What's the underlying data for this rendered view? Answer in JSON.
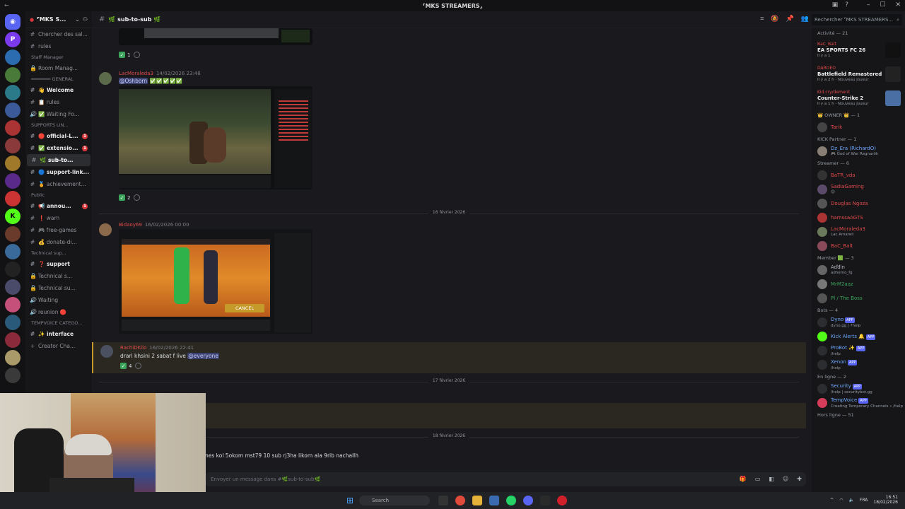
{
  "window": {
    "title": "⸢MKS STREAMERS⸥",
    "search_placeholder": "Rechercher ⸢MKS STREAMERS..."
  },
  "server": {
    "name": "⸢MKS S..."
  },
  "channels": [
    {
      "type": "channel",
      "icon": "hash-icon",
      "label": "Chercher des sal..."
    },
    {
      "type": "channel",
      "icon": "hash-icon",
      "label": "rules"
    },
    {
      "type": "category",
      "label": "Staff Manager"
    },
    {
      "type": "channel",
      "icon": "lock-icon",
      "label": "Room Manag..."
    },
    {
      "type": "category",
      "label": "━━━━━━━ GENERAL"
    },
    {
      "type": "channel",
      "icon": "hash-icon",
      "label": "👋 Welcome",
      "bold": true
    },
    {
      "type": "channel",
      "icon": "hash-icon",
      "label": "📋 rules"
    },
    {
      "type": "channel",
      "icon": "speaker-icon",
      "label": "✅ Waiting Fo..."
    },
    {
      "type": "category",
      "label": "SUPPORTS LIN..."
    },
    {
      "type": "channel",
      "icon": "hash-icon",
      "label": "🔴 official-L...",
      "bold": true,
      "badge": "1"
    },
    {
      "type": "channel",
      "icon": "hash-icon",
      "label": "✅ extensio...",
      "bold": true,
      "badge": "1"
    },
    {
      "type": "channel",
      "icon": "hash-icon",
      "label": "🌿 sub-to...",
      "bold": true,
      "active": true
    },
    {
      "type": "channel",
      "icon": "hash-icon",
      "label": "🔵 support-link...",
      "bold": true
    },
    {
      "type": "channel",
      "icon": "hash-icon",
      "label": "🏅 achievement..."
    },
    {
      "type": "category",
      "label": "Public"
    },
    {
      "type": "channel",
      "icon": "hash-icon",
      "label": "📢 annou...",
      "bold": true,
      "badge": "1"
    },
    {
      "type": "channel",
      "icon": "hash-icon",
      "label": "❗ warn"
    },
    {
      "type": "channel",
      "icon": "hash-icon",
      "label": "🎮 free-games"
    },
    {
      "type": "channel",
      "icon": "hash-icon",
      "label": "💰 donate-di..."
    },
    {
      "type": "category",
      "label": "Technical sup..."
    },
    {
      "type": "channel",
      "icon": "hash-icon",
      "label": "❓ support",
      "bold": true
    },
    {
      "type": "channel",
      "icon": "lock-icon",
      "label": "Technical s..."
    },
    {
      "type": "channel",
      "icon": "lock-icon",
      "label": "Technical su..."
    },
    {
      "type": "channel",
      "icon": "speaker-icon",
      "label": "Waiting"
    },
    {
      "type": "channel",
      "icon": "speaker-icon",
      "label": "reunion 🔴"
    },
    {
      "type": "category",
      "label": "TEMPVOICE CATEGO..."
    },
    {
      "type": "channel",
      "icon": "hash-icon",
      "label": "✨ interface",
      "bold": true
    },
    {
      "type": "channel",
      "icon": "plus-icon",
      "label": "Creator Cha..."
    }
  ],
  "topbar": {
    "channel": "🌿 sub-to-sub 🌿"
  },
  "messages": {
    "m1": {
      "reaction_count": "1"
    },
    "m2": {
      "author": "LacMoraleda3",
      "timestamp": "14/02/2026 23:48",
      "mention": "@Oshborn",
      "emoji": "✅✅✅✅✅",
      "reaction_count": "2"
    },
    "divider1": "16 février 2026",
    "m3": {
      "author": "Bidaoy69",
      "timestamp": "16/02/2026 00:00",
      "embed_button": "CANCEL"
    },
    "m4": {
      "author": "RachiDKilo",
      "timestamp": "16/02/2026 22:41",
      "text": "drari khsini 2 sabat f live",
      "mention": "@everyone",
      "reaction_count": "4"
    },
    "divider2": "17 février 2026",
    "divider3": "18 février 2026",
    "m5": {
      "text": "nes kol 5okom mst79 10 sub rj3ha likom ala 9rib nachallh"
    }
  },
  "composer": {
    "placeholder": "Envoyer un message dans #🌿sub-to-sub🌿"
  },
  "members": {
    "activity_header": "Activité — 21",
    "activities": [
      {
        "user": "BaC_Balt",
        "game": "EA SPORTS FC 26",
        "meta": "Il y a 1",
        "thumb_color": "#111111"
      },
      {
        "user": "DARDEO",
        "game": "Battlefield Remastered",
        "meta": "Il y a 2 h · Nouveau joueur",
        "thumb_color": "#222222"
      },
      {
        "user": "Kid.cry/dement",
        "game": "Counter-Strike 2",
        "meta": "Il y a 1 h · Nouveau joueur",
        "thumb_color": "#4a6fa5"
      }
    ],
    "groups": [
      {
        "header": "👑 OWNER 👑 — 1",
        "members": [
          {
            "name": "Tarik",
            "sub": "",
            "color": "#e04a4a",
            "avatar": "#444"
          }
        ]
      },
      {
        "header": "KICK Partner — 1",
        "members": [
          {
            "name": "Dz_Era (RichardO)",
            "sub": "🎮 God of War Ragnarök",
            "color": "#6ea8ff",
            "avatar": "#8a7f74"
          }
        ]
      },
      {
        "header": "Streamer — 6",
        "members": [
          {
            "name": "BaTR_vda",
            "sub": "",
            "color": "#e04a4a",
            "avatar": "#333"
          },
          {
            "name": "SadiaGaming",
            "sub": "😊",
            "color": "#e04a4a",
            "avatar": "#5c4a6a"
          },
          {
            "name": "Douglas Ngoza",
            "sub": "",
            "color": "#e04a4a",
            "avatar": "#555"
          },
          {
            "name": "hamssaAGTS",
            "sub": "",
            "color": "#e04a4a",
            "avatar": "#a33"
          },
          {
            "name": "LacMoraleda3",
            "sub": "Lac Amarell",
            "color": "#e04a4a",
            "avatar": "#6a7a5a"
          },
          {
            "name": "BaC_Balt",
            "sub": "",
            "color": "#e04a4a",
            "avatar": "#8a4a5a"
          }
        ]
      },
      {
        "header": "Member 🟩 — 3",
        "members": [
          {
            "name": "Aďđin",
            "sub": "adhemo_fg",
            "color": "#b0b4ba",
            "avatar": "#666"
          },
          {
            "name": "MrM2aaz",
            "sub": "",
            "color": "#3ba55c",
            "avatar": "#777"
          },
          {
            "name": "Pl / The Boss",
            "sub": "",
            "color": "#3ba55c",
            "avatar": "#555"
          }
        ]
      },
      {
        "header": "Bots — 4",
        "members": [
          {
            "name": "Dyno",
            "sub": "dyno.gg | ?help",
            "color": "#6ea8ff",
            "avatar": "#2b2d31",
            "tag": "APP"
          },
          {
            "name": "Kick Alerts 🔔",
            "sub": "",
            "color": "#6ea8ff",
            "avatar": "#53fc18",
            "tag": "APP"
          },
          {
            "name": "ProBot ✨",
            "sub": "/help",
            "color": "#6ea8ff",
            "avatar": "#2b2d31",
            "tag": "APP"
          },
          {
            "name": "Xenon",
            "sub": "/help",
            "color": "#6ea8ff",
            "avatar": "#2b2d31",
            "tag": "APP"
          }
        ]
      },
      {
        "header": "En ligne — 2",
        "members": [
          {
            "name": "Security",
            "sub": "/help | securitybot.gg",
            "color": "#6ea8ff",
            "avatar": "#2b2d31",
            "tag": "APP"
          },
          {
            "name": "TempVoice",
            "sub": "Creating Temporary Channels • /help",
            "color": "#6ea8ff",
            "avatar": "#d83c5b",
            "tag": "APP"
          }
        ]
      }
    ],
    "offline_header": "Hors ligne — 51"
  },
  "taskbar": {
    "search": "Search",
    "time": "16:51",
    "date": "18/02/2026",
    "lang": "FRA"
  }
}
